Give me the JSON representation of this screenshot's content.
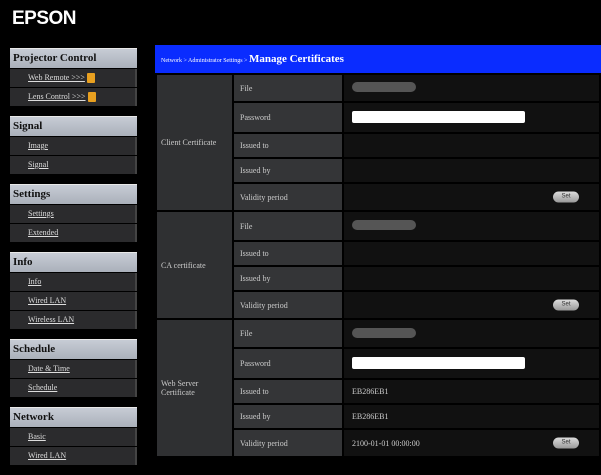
{
  "brand": "EPSON",
  "sidebar": [
    {
      "title": "Projector Control",
      "items": [
        "Web Remote >>>",
        "Lens Control >>>"
      ]
    },
    {
      "title": "Signal",
      "items": [
        "Image",
        "Signal"
      ]
    },
    {
      "title": "Settings",
      "items": [
        "Settings",
        "Extended"
      ]
    },
    {
      "title": "Info",
      "items": [
        "Info",
        "Wired LAN",
        "Wireless LAN"
      ]
    },
    {
      "title": "Schedule",
      "items": [
        "Date & Time",
        "Schedule"
      ]
    },
    {
      "title": "Network",
      "items": [
        "Basic",
        "Wired LAN"
      ]
    }
  ],
  "header": {
    "breadcrumb": "Network > Administrator Settings > ",
    "title": "Manage Certificates"
  },
  "labels": {
    "file": "File",
    "password": "Password",
    "issued_to": "Issued to",
    "issued_by": "Issued by",
    "validity": "Validity period",
    "set": "Set"
  },
  "client": {
    "title": "Client Certificate"
  },
  "ca": {
    "title": "CA certificate"
  },
  "web": {
    "title": "Web Server Certificate",
    "issued_to": "EB286EB1",
    "issued_by": "EB286EB1",
    "validity": "2100-01-01 00:00:00"
  }
}
